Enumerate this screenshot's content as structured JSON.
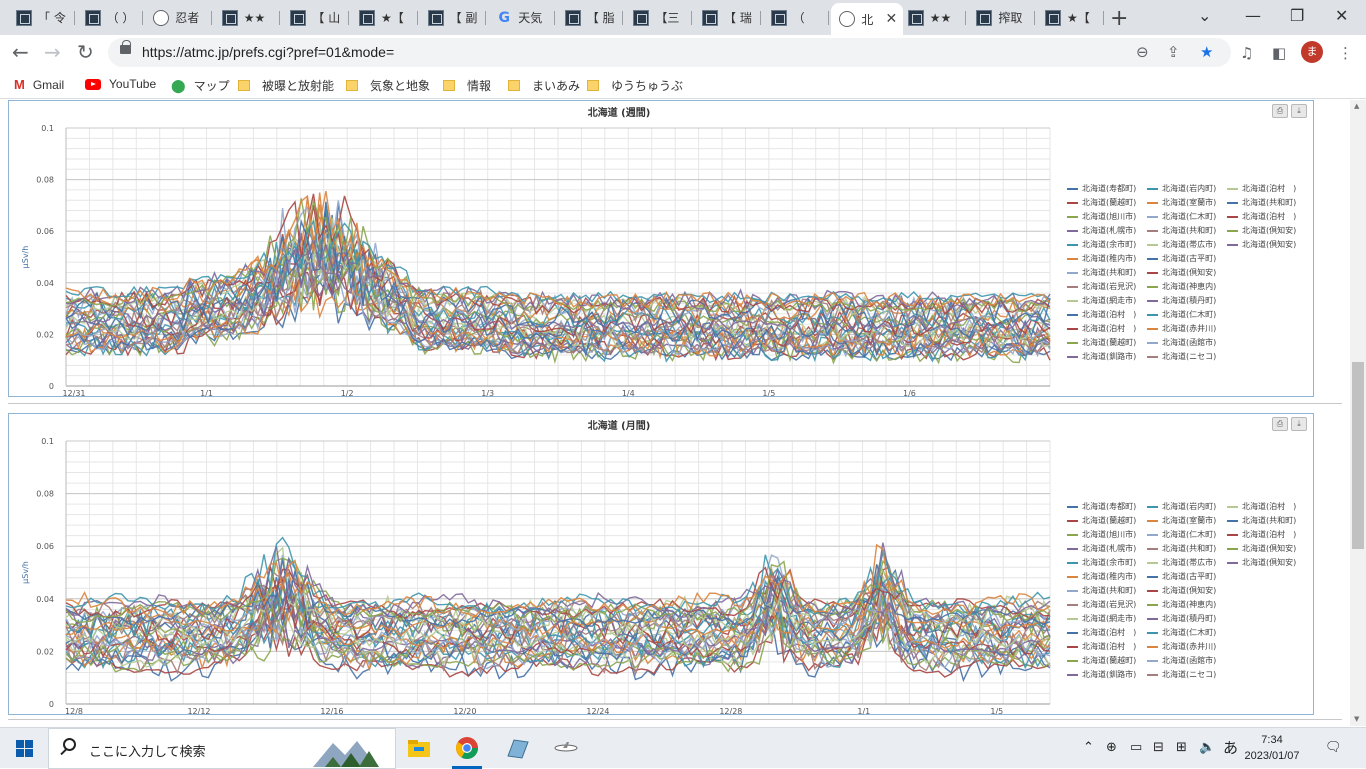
{
  "browser": {
    "tabs": [
      {
        "title": "「 令",
        "icon": "atmc-icon"
      },
      {
        "title": "（ ）",
        "icon": "atmc-icon"
      },
      {
        "title": "忍者",
        "icon": "globe-icon"
      },
      {
        "title": "★★",
        "icon": "atmc-icon"
      },
      {
        "title": "【 山",
        "icon": "atmc-icon"
      },
      {
        "title": "★【",
        "icon": "atmc-icon"
      },
      {
        "title": "【 副",
        "icon": "atmc-icon"
      },
      {
        "title": "天気",
        "icon": "google-icon"
      },
      {
        "title": "【 脂",
        "icon": "atmc-icon"
      },
      {
        "title": "【三",
        "icon": "atmc-icon"
      },
      {
        "title": "【 瑞",
        "icon": "atmc-icon"
      },
      {
        "title": "（ ",
        "icon": "atmc-icon"
      },
      {
        "title": "北",
        "icon": "globe-icon",
        "active": true
      },
      {
        "title": "★★",
        "icon": "atmc-icon"
      },
      {
        "title": "搾取",
        "icon": "atmc-icon"
      },
      {
        "title": "★【",
        "icon": "atmc-icon"
      }
    ],
    "url": "https://atmc.jp/prefs.cgi?pref=01&mode=",
    "avatar_letter": "ま",
    "bookmarks": [
      {
        "label": "Gmail",
        "icon": "gmail-icon"
      },
      {
        "label": "YouTube",
        "icon": "youtube-icon"
      },
      {
        "label": "マップ",
        "icon": "maps-icon"
      },
      {
        "label": "被曝と放射能",
        "icon": "folder-icon"
      },
      {
        "label": "気象と地象",
        "icon": "folder-icon"
      },
      {
        "label": "情報",
        "icon": "folder-icon"
      },
      {
        "label": "まいあみ",
        "icon": "folder-icon"
      },
      {
        "label": "ゆうちゅうぶ",
        "icon": "folder-icon"
      }
    ]
  },
  "legend_entries": [
    [
      "北海道(寿都町)",
      "北海道(岩内町)",
      "北海道(泊村　)"
    ],
    [
      "北海道(蘭越町)",
      "北海道(室蘭市)",
      "北海道(共和町)"
    ],
    [
      "北海道(旭川市)",
      "北海道(仁木町)",
      "北海道(泊村　)"
    ],
    [
      "北海道(札幌市)",
      "北海道(共和町)",
      "北海道(倶知安)"
    ],
    [
      "北海道(余市町)",
      "北海道(帯広市)",
      "北海道(倶知安)"
    ],
    [
      "北海道(稚内市)",
      "北海道(古平町)",
      ""
    ],
    [
      "北海道(共和町)",
      "北海道(倶知安)",
      ""
    ],
    [
      "北海道(岩見沢)",
      "北海道(神恵内)",
      ""
    ],
    [
      "北海道(網走市)",
      "北海道(積丹町)",
      ""
    ],
    [
      "北海道(泊村　)",
      "北海道(仁木町)",
      ""
    ],
    [
      "北海道(泊村　)",
      "北海道(赤井川)",
      ""
    ],
    [
      "北海道(蘭越町)",
      "北海道(函館市)",
      ""
    ],
    [
      "北海道(釧路市)",
      "北海道(ニセコ)",
      ""
    ]
  ],
  "series_colors": [
    "#4572A7",
    "#AA4643",
    "#89A54E",
    "#80699B",
    "#3D96AE",
    "#DB843D",
    "#92A8CD",
    "#A47D7C",
    "#B5CA92",
    "#4572A7",
    "#AA4643",
    "#89A54E",
    "#80699B",
    "#3D96AE",
    "#DB843D",
    "#92A8CD",
    "#A47D7C",
    "#B5CA92",
    "#4572A7",
    "#AA4643",
    "#89A54E",
    "#80699B",
    "#3D96AE",
    "#DB843D",
    "#92A8CD",
    "#A47D7C",
    "#B5CA92",
    "#4572A7",
    "#AA4643",
    "#89A54E",
    "#80699B",
    "#3D96AE",
    "#DB843D"
  ],
  "chart_data": [
    {
      "type": "line",
      "title": "北海道 (週間)",
      "ylabel": "μSv/h",
      "xlabel": "",
      "ylim": [
        0,
        0.1
      ],
      "yticks": [
        "0",
        "0.02",
        "0.04",
        "0.06",
        "0.08",
        "0.1"
      ],
      "xticks": [
        "12/31",
        "1/1",
        "1/2",
        "1/3",
        "1/4",
        "1/5",
        "1/6"
      ],
      "n_series": 33,
      "peak_x_fraction": 0.26,
      "peak_value": 0.085,
      "baseline_range": [
        0.012,
        0.037
      ],
      "legend": "right"
    },
    {
      "type": "line",
      "title": "北海道 (月間)",
      "ylabel": "μSv/h",
      "xlabel": "",
      "ylim": [
        0,
        0.1
      ],
      "yticks": [
        "0",
        "0.02",
        "0.04",
        "0.06",
        "0.08",
        "0.1"
      ],
      "xticks": [
        "12/8",
        "12/12",
        "12/16",
        "12/20",
        "12/24",
        "12/28",
        "1/1",
        "1/5"
      ],
      "n_series": 33,
      "peaks": [
        {
          "x": "12/15",
          "value": 0.061
        },
        {
          "x": "12/29",
          "value": 0.077
        },
        {
          "x": "1/1",
          "value": 0.069
        }
      ],
      "baseline_range": [
        0.013,
        0.04
      ],
      "legend": "right"
    }
  ],
  "taskbar": {
    "search_placeholder": "ここに入力して検索",
    "time": "7:34",
    "date": "2023/01/07",
    "ime": "あ"
  }
}
